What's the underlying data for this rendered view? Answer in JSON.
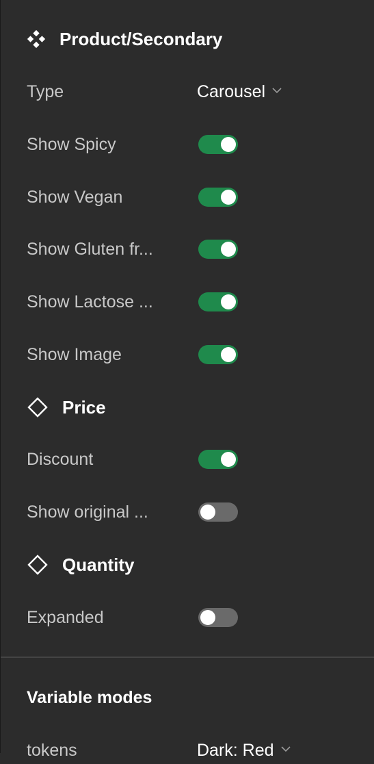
{
  "component": {
    "title": "Product/Secondary",
    "icon": "component-icon"
  },
  "properties": {
    "type_label": "Type",
    "type_value": "Carousel",
    "show_spicy": {
      "label": "Show Spicy",
      "on": true
    },
    "show_vegan": {
      "label": "Show Vegan",
      "on": true
    },
    "show_gluten": {
      "label": "Show Gluten fr...",
      "on": true
    },
    "show_lactose": {
      "label": "Show Lactose ...",
      "on": true
    },
    "show_image": {
      "label": "Show Image",
      "on": true
    }
  },
  "price": {
    "title": "Price",
    "icon": "instance-diamond-icon",
    "discount": {
      "label": "Discount",
      "on": true
    },
    "show_original": {
      "label": "Show original ...",
      "on": false
    }
  },
  "quantity": {
    "title": "Quantity",
    "icon": "instance-diamond-icon",
    "expanded": {
      "label": "Expanded",
      "on": false
    }
  },
  "variable_modes": {
    "title": "Variable modes",
    "tokens_label": "tokens",
    "tokens_value": "Dark: Red"
  },
  "colors": {
    "toggle_on": "#1f8a4c",
    "toggle_off": "#6a6a6a",
    "panel_bg": "#2c2c2c"
  }
}
